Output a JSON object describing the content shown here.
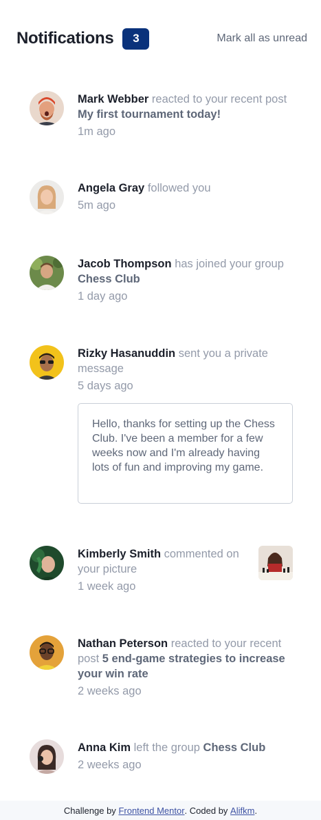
{
  "header": {
    "title": "Notifications",
    "unread_count": "3",
    "mark_all": "Mark all as unread"
  },
  "notifications": [
    {
      "user": "Mark Webber",
      "action": "reacted to your recent post",
      "target": "My first tournament today!",
      "time": "1m ago",
      "avatar": "avatar-mark-webber"
    },
    {
      "user": "Angela Gray",
      "action": "followed you",
      "target": "",
      "time": "5m ago",
      "avatar": "avatar-angela-gray"
    },
    {
      "user": "Jacob Thompson",
      "action": "has joined your group",
      "target": "Chess Club",
      "time": "1 day ago",
      "avatar": "avatar-jacob-thompson"
    },
    {
      "user": "Rizky Hasanuddin",
      "action": "sent you a private message",
      "target": "",
      "time": "5 days ago",
      "avatar": "avatar-rizky-hasanuddin",
      "message": "Hello, thanks for setting up the Chess Club. I've been a member for a few weeks now and I'm already having lots of fun and improving my game."
    },
    {
      "user": "Kimberly Smith",
      "action": "commented on your picture",
      "target": "",
      "time": "1 week ago",
      "avatar": "avatar-kimberly-smith",
      "picture": "chess-picture"
    },
    {
      "user": "Nathan Peterson",
      "action": "reacted to your recent post",
      "target": "5 end-game strategies to increase your win rate",
      "time": "2 weeks ago",
      "avatar": "avatar-nathan-peterson"
    },
    {
      "user": "Anna Kim",
      "action": "left the group",
      "target": "Chess Club",
      "time": "2 weeks ago",
      "avatar": "avatar-anna-kim"
    }
  ],
  "footer": {
    "prefix": "Challenge by",
    "link1": "Frontend Mentor",
    "middle": ". Coded by",
    "link2": "Alifkm",
    "suffix": "."
  },
  "colors": {
    "badge": "#0a327b",
    "name": "#1c202b",
    "muted": "#939aa9",
    "target": "#5e6778",
    "border": "#c9cfd8",
    "footer_bg": "#f6f8fb",
    "link": "#3e52a3"
  }
}
